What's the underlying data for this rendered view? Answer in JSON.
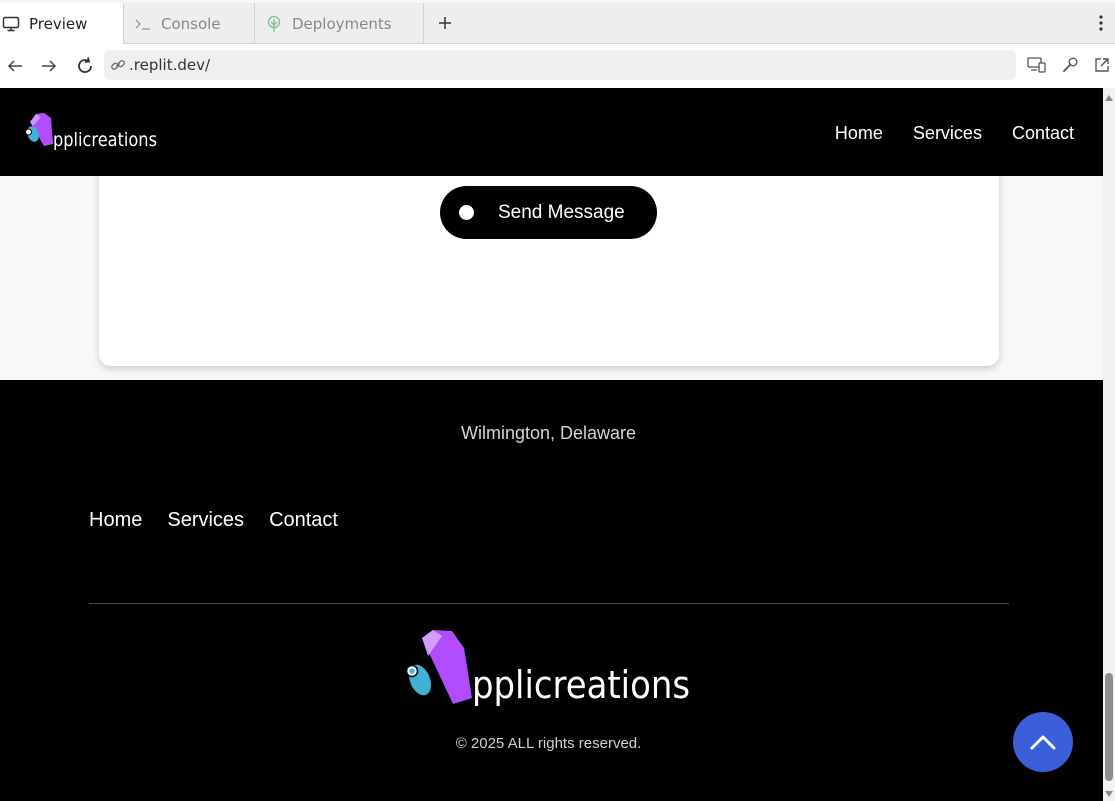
{
  "browser": {
    "tabs": [
      {
        "label": "Preview",
        "icon": "monitor-icon",
        "active": true
      },
      {
        "label": "Console",
        "icon": "terminal-icon",
        "active": false
      },
      {
        "label": "Deployments",
        "icon": "deploy-tree-icon",
        "active": false
      }
    ],
    "url": ".replit.dev/"
  },
  "site": {
    "brand": "pplicreations",
    "nav": [
      "Home",
      "Services",
      "Contact"
    ],
    "send_button_label": "Send Message",
    "footer_address": "Wilmington, Delaware",
    "footer_nav": [
      "Home",
      "Services",
      "Contact"
    ],
    "copyright": "© 2025 ALL rights reserved."
  },
  "colors": {
    "header_bg": "#000000",
    "logo_purple": "#b14dff",
    "logo_teal": "#3fb1d6",
    "scroll_top_button": "#3a5fd9"
  }
}
